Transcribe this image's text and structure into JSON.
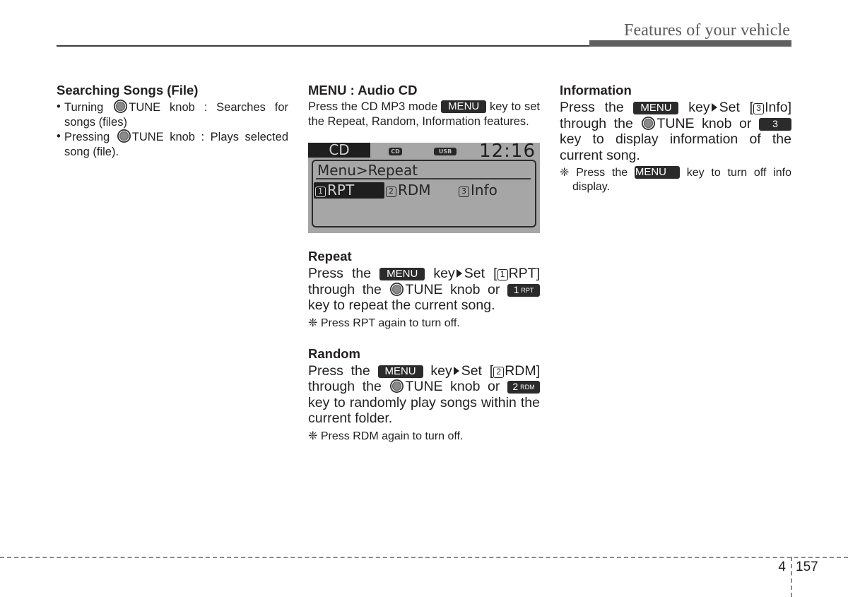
{
  "header": {
    "title": "Features of your vehicle"
  },
  "icons": {
    "knob": "tune-knob-icon",
    "arrow": "right-triangle-icon",
    "note_symbol": "❈"
  },
  "col1": {
    "heading": "Searching Songs (File)",
    "bullets": [
      {
        "pre": "Turning",
        "knob_label": "TUNE knob",
        "post": ": Searches for songs (files)"
      },
      {
        "pre": "Pressing",
        "knob_label": "TUNE knob",
        "post": ": Plays selected song (file)."
      }
    ]
  },
  "col2": {
    "menu": {
      "heading": "MENU : Audio CD",
      "text_pre": "Press the CD MP3 mode",
      "key": "MENU",
      "text_post": "key to set the Repeat, Random, Information features."
    },
    "lcd": {
      "mode": "CD",
      "badge_cd": "CD",
      "badge_usb": "USB",
      "clock": "12:16",
      "path": "Menu>Repeat",
      "options": [
        {
          "num": "1",
          "label": "RPT",
          "selected": true
        },
        {
          "num": "2",
          "label": "RDM",
          "selected": false
        },
        {
          "num": "3",
          "label": "Info",
          "selected": false
        }
      ]
    },
    "repeat": {
      "heading": "Repeat",
      "press_the": "Press the",
      "key": "MENU",
      "key_set": "key",
      "set_label": "Set [",
      "set_num": "1",
      "set_item": "RPT]",
      "through": "through the",
      "knob_label": "TUNE knob or",
      "num_key": "1",
      "num_key_sub": "RPT",
      "tail": "key to repeat the current song.",
      "note": "Press RPT again to turn off."
    },
    "random": {
      "heading": "Random",
      "press_the": "Press the",
      "key": "MENU",
      "key_set": "key",
      "set_label": "Set [",
      "set_num": "2",
      "set_item": "RDM]",
      "through": "through the",
      "knob_label": "TUNE knob or",
      "num_key": "2",
      "num_key_sub": "RDM",
      "tail": "key to randomly play songs within the current folder.",
      "note": "Press RDM again to turn off."
    }
  },
  "col3": {
    "info": {
      "heading": "Information",
      "press_the": "Press the",
      "key": "MENU",
      "key_set": "key",
      "set_label": "Set [",
      "set_num": "3",
      "set_item": "Info]",
      "through": "through the",
      "knob_label": "TUNE knob or",
      "num_key": "3",
      "tail": "key to display information of the current song.",
      "note_pre": "Press the",
      "note_key": "MENU",
      "note_post": "key to turn off info display."
    }
  },
  "footer": {
    "chapter": "4",
    "page": "157"
  }
}
